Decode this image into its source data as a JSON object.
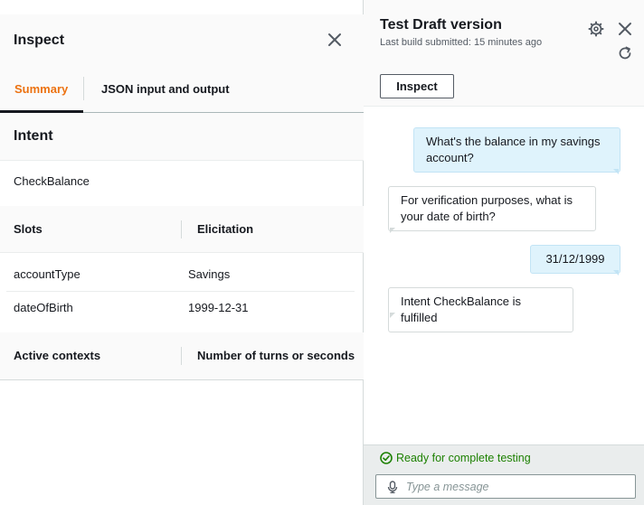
{
  "inspect": {
    "title": "Inspect",
    "tabs": [
      {
        "label": "Summary",
        "active": true
      },
      {
        "label": "JSON input and output",
        "active": false
      }
    ],
    "intent_heading": "Intent",
    "intent_value": "CheckBalance",
    "slots_table": {
      "headers": [
        "Slots",
        "Elicitation"
      ],
      "rows": [
        {
          "slot": "accountType",
          "value": "Savings"
        },
        {
          "slot": "dateOfBirth",
          "value": "1999-12-31"
        }
      ]
    },
    "contexts_table": {
      "headers": [
        "Active contexts",
        "Number of turns or seconds"
      ]
    }
  },
  "test": {
    "title": "Test Draft version",
    "subtitle": "Last build submitted: 15 minutes ago",
    "inspect_button": "Inspect",
    "messages": [
      {
        "from": "user",
        "text": "What's the balance in my savings account?"
      },
      {
        "from": "bot",
        "text": "For verification purposes, what is your date of birth?"
      },
      {
        "from": "user",
        "text": "31/12/1999"
      },
      {
        "from": "bot",
        "text": "Intent CheckBalance is fulfilled"
      }
    ],
    "status": "Ready for complete testing",
    "input_placeholder": "Type a message"
  },
  "colors": {
    "accent_tab": "#ec7211",
    "status_success": "#1d8102",
    "user_bubble": "#dff3fc"
  },
  "icons": [
    "close-icon",
    "settings-icon",
    "refresh-icon",
    "check-circle-icon",
    "microphone-icon"
  ]
}
